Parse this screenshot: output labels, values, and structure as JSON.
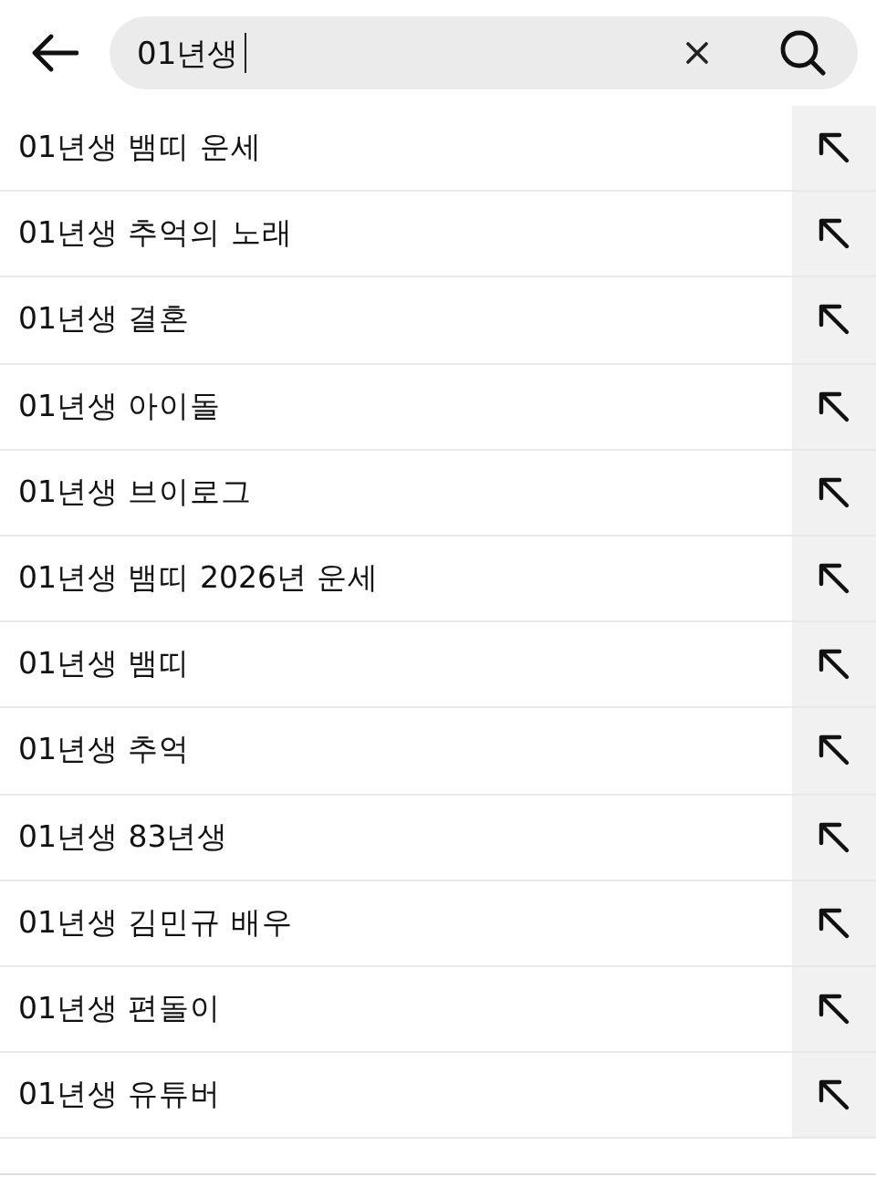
{
  "search": {
    "value": "01년생"
  },
  "suggestions": [
    {
      "text": "01년생 뱀띠 운세"
    },
    {
      "text": "01년생 추억의 노래"
    },
    {
      "text": "01년생 결혼"
    },
    {
      "text": "01년생 아이돌"
    },
    {
      "text": "01년생 브이로그"
    },
    {
      "text": "01년생 뱀띠 2026년 운세"
    },
    {
      "text": "01년생 뱀띠"
    },
    {
      "text": "01년생 추억"
    },
    {
      "text": "01년생 83년생"
    },
    {
      "text": "01년생 김민규 배우"
    },
    {
      "text": "01년생 편돌이"
    },
    {
      "text": "01년생 유튜버"
    }
  ]
}
